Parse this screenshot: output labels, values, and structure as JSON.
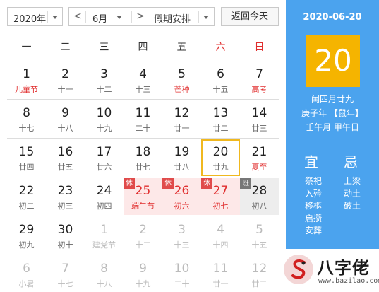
{
  "toolbar": {
    "year_value": "2020年",
    "month_value": "6月",
    "holiday_select": "假期安排",
    "prev_glyph": "<",
    "next_glyph": ">",
    "today_button": "返回今天"
  },
  "weekdays": [
    {
      "label": "一",
      "weekend": false
    },
    {
      "label": "二",
      "weekend": false
    },
    {
      "label": "三",
      "weekend": false
    },
    {
      "label": "四",
      "weekend": false
    },
    {
      "label": "五",
      "weekend": false
    },
    {
      "label": "六",
      "weekend": true
    },
    {
      "label": "日",
      "weekend": true
    }
  ],
  "weeks": [
    [
      {
        "day": "1",
        "sub": "儿童节",
        "type": "festival"
      },
      {
        "day": "2",
        "sub": "十一"
      },
      {
        "day": "3",
        "sub": "十二"
      },
      {
        "day": "4",
        "sub": "十三"
      },
      {
        "day": "5",
        "sub": "芒种",
        "type": "festival"
      },
      {
        "day": "6",
        "sub": "十五",
        "type": "weekend"
      },
      {
        "day": "7",
        "sub": "高考",
        "type": "weekend festival"
      }
    ],
    [
      {
        "day": "8",
        "sub": "十七"
      },
      {
        "day": "9",
        "sub": "十八"
      },
      {
        "day": "10",
        "sub": "十九"
      },
      {
        "day": "11",
        "sub": "二十"
      },
      {
        "day": "12",
        "sub": "廿一"
      },
      {
        "day": "13",
        "sub": "廿二",
        "type": "weekend"
      },
      {
        "day": "14",
        "sub": "廿三",
        "type": "weekend"
      }
    ],
    [
      {
        "day": "15",
        "sub": "廿四"
      },
      {
        "day": "16",
        "sub": "廿五"
      },
      {
        "day": "17",
        "sub": "廿六"
      },
      {
        "day": "18",
        "sub": "廿七"
      },
      {
        "day": "19",
        "sub": "廿八"
      },
      {
        "day": "20",
        "sub": "廿九",
        "type": "weekend today"
      },
      {
        "day": "21",
        "sub": "夏至",
        "type": "weekend festival"
      }
    ],
    [
      {
        "day": "22",
        "sub": "初二"
      },
      {
        "day": "23",
        "sub": "初三"
      },
      {
        "day": "24",
        "sub": "初四"
      },
      {
        "day": "25",
        "sub": "端午节",
        "type": "holiday",
        "badge": "休"
      },
      {
        "day": "26",
        "sub": "初六",
        "type": "holiday",
        "badge": "休"
      },
      {
        "day": "27",
        "sub": "初七",
        "type": "holiday",
        "badge": "休"
      },
      {
        "day": "28",
        "sub": "初八",
        "type": "workday",
        "badge": "班"
      }
    ],
    [
      {
        "day": "29",
        "sub": "初九"
      },
      {
        "day": "30",
        "sub": "初十"
      },
      {
        "day": "1",
        "sub": "建党节",
        "type": "other"
      },
      {
        "day": "2",
        "sub": "十二",
        "type": "other"
      },
      {
        "day": "3",
        "sub": "十三",
        "type": "other"
      },
      {
        "day": "4",
        "sub": "十四",
        "type": "other"
      },
      {
        "day": "5",
        "sub": "十五",
        "type": "other"
      }
    ],
    [
      {
        "day": "6",
        "sub": "小暑",
        "type": "other"
      },
      {
        "day": "7",
        "sub": "十七",
        "type": "other"
      },
      {
        "day": "8",
        "sub": "十八",
        "type": "other"
      },
      {
        "day": "9",
        "sub": "十九",
        "type": "other"
      },
      {
        "day": "10",
        "sub": "二十",
        "type": "other"
      },
      {
        "day": "11",
        "sub": "廿一",
        "type": "other"
      },
      {
        "day": "12",
        "sub": "廿二",
        "type": "other"
      }
    ]
  ],
  "detail": {
    "date": "2020-06-20",
    "day": "20",
    "lunar": "闰四月廿九",
    "ganzhi_year": "庚子年 【鼠年】",
    "ganzhi_month_day": "壬午月 甲午日",
    "yi_label": "宜",
    "ji_label": "忌",
    "yi_items": [
      "祭祀",
      "入殓",
      "移柩",
      "启攒",
      "安葬"
    ],
    "ji_items": [
      "上梁",
      "动土",
      "破土"
    ]
  },
  "logo": {
    "text": "八字佬",
    "url": "www.bazilao.com"
  },
  "colors": {
    "panel_blue": "#4ba3ee",
    "today_yellow": "#f5b400",
    "today_border": "#f0b81f",
    "red": "#e02d2d",
    "holiday_bg": "#fde8e8",
    "workday_bg": "#ededed"
  }
}
